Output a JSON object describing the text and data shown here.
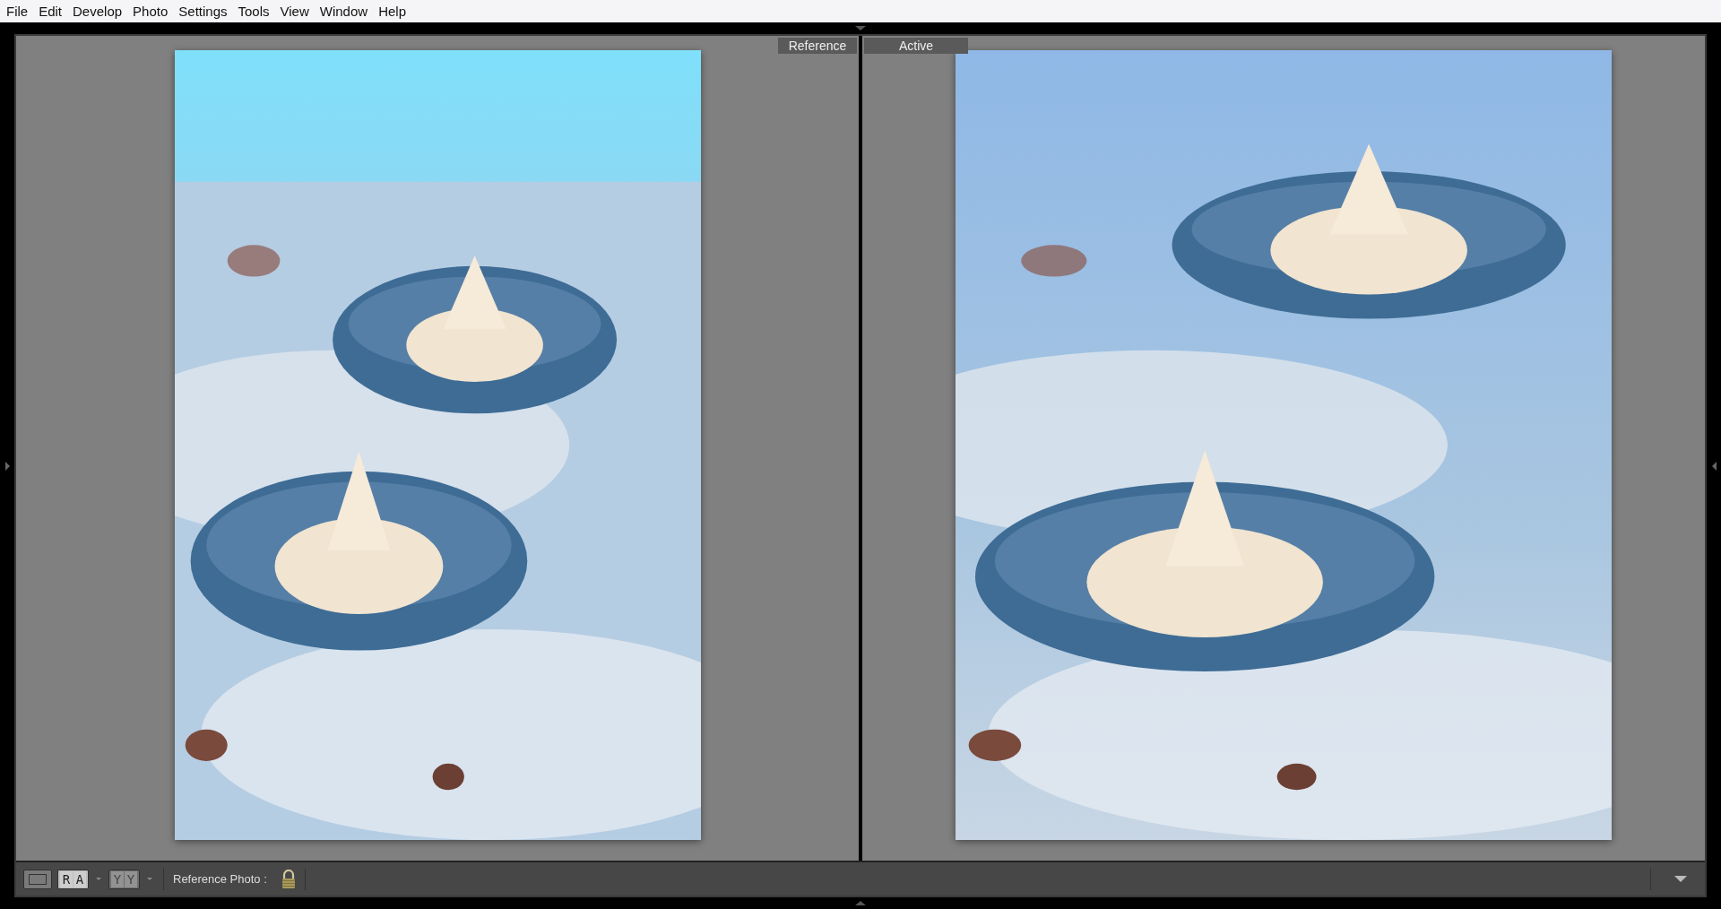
{
  "menu": [
    "File",
    "Edit",
    "Develop",
    "Photo",
    "Settings",
    "Tools",
    "View",
    "Window",
    "Help"
  ],
  "panes": [
    {
      "label": "Reference"
    },
    {
      "label": "Active"
    }
  ],
  "toolbar": {
    "view_buttons": [
      {
        "kind": "loupe",
        "selected": false
      },
      {
        "kind": "letters",
        "letters": [
          "R",
          "A"
        ],
        "selected": true,
        "has_menu": true
      },
      {
        "kind": "letters",
        "letters": [
          "Y",
          "Y"
        ],
        "selected": false,
        "has_menu": true
      }
    ],
    "reference_label": "Reference Photo :",
    "locked": true
  }
}
